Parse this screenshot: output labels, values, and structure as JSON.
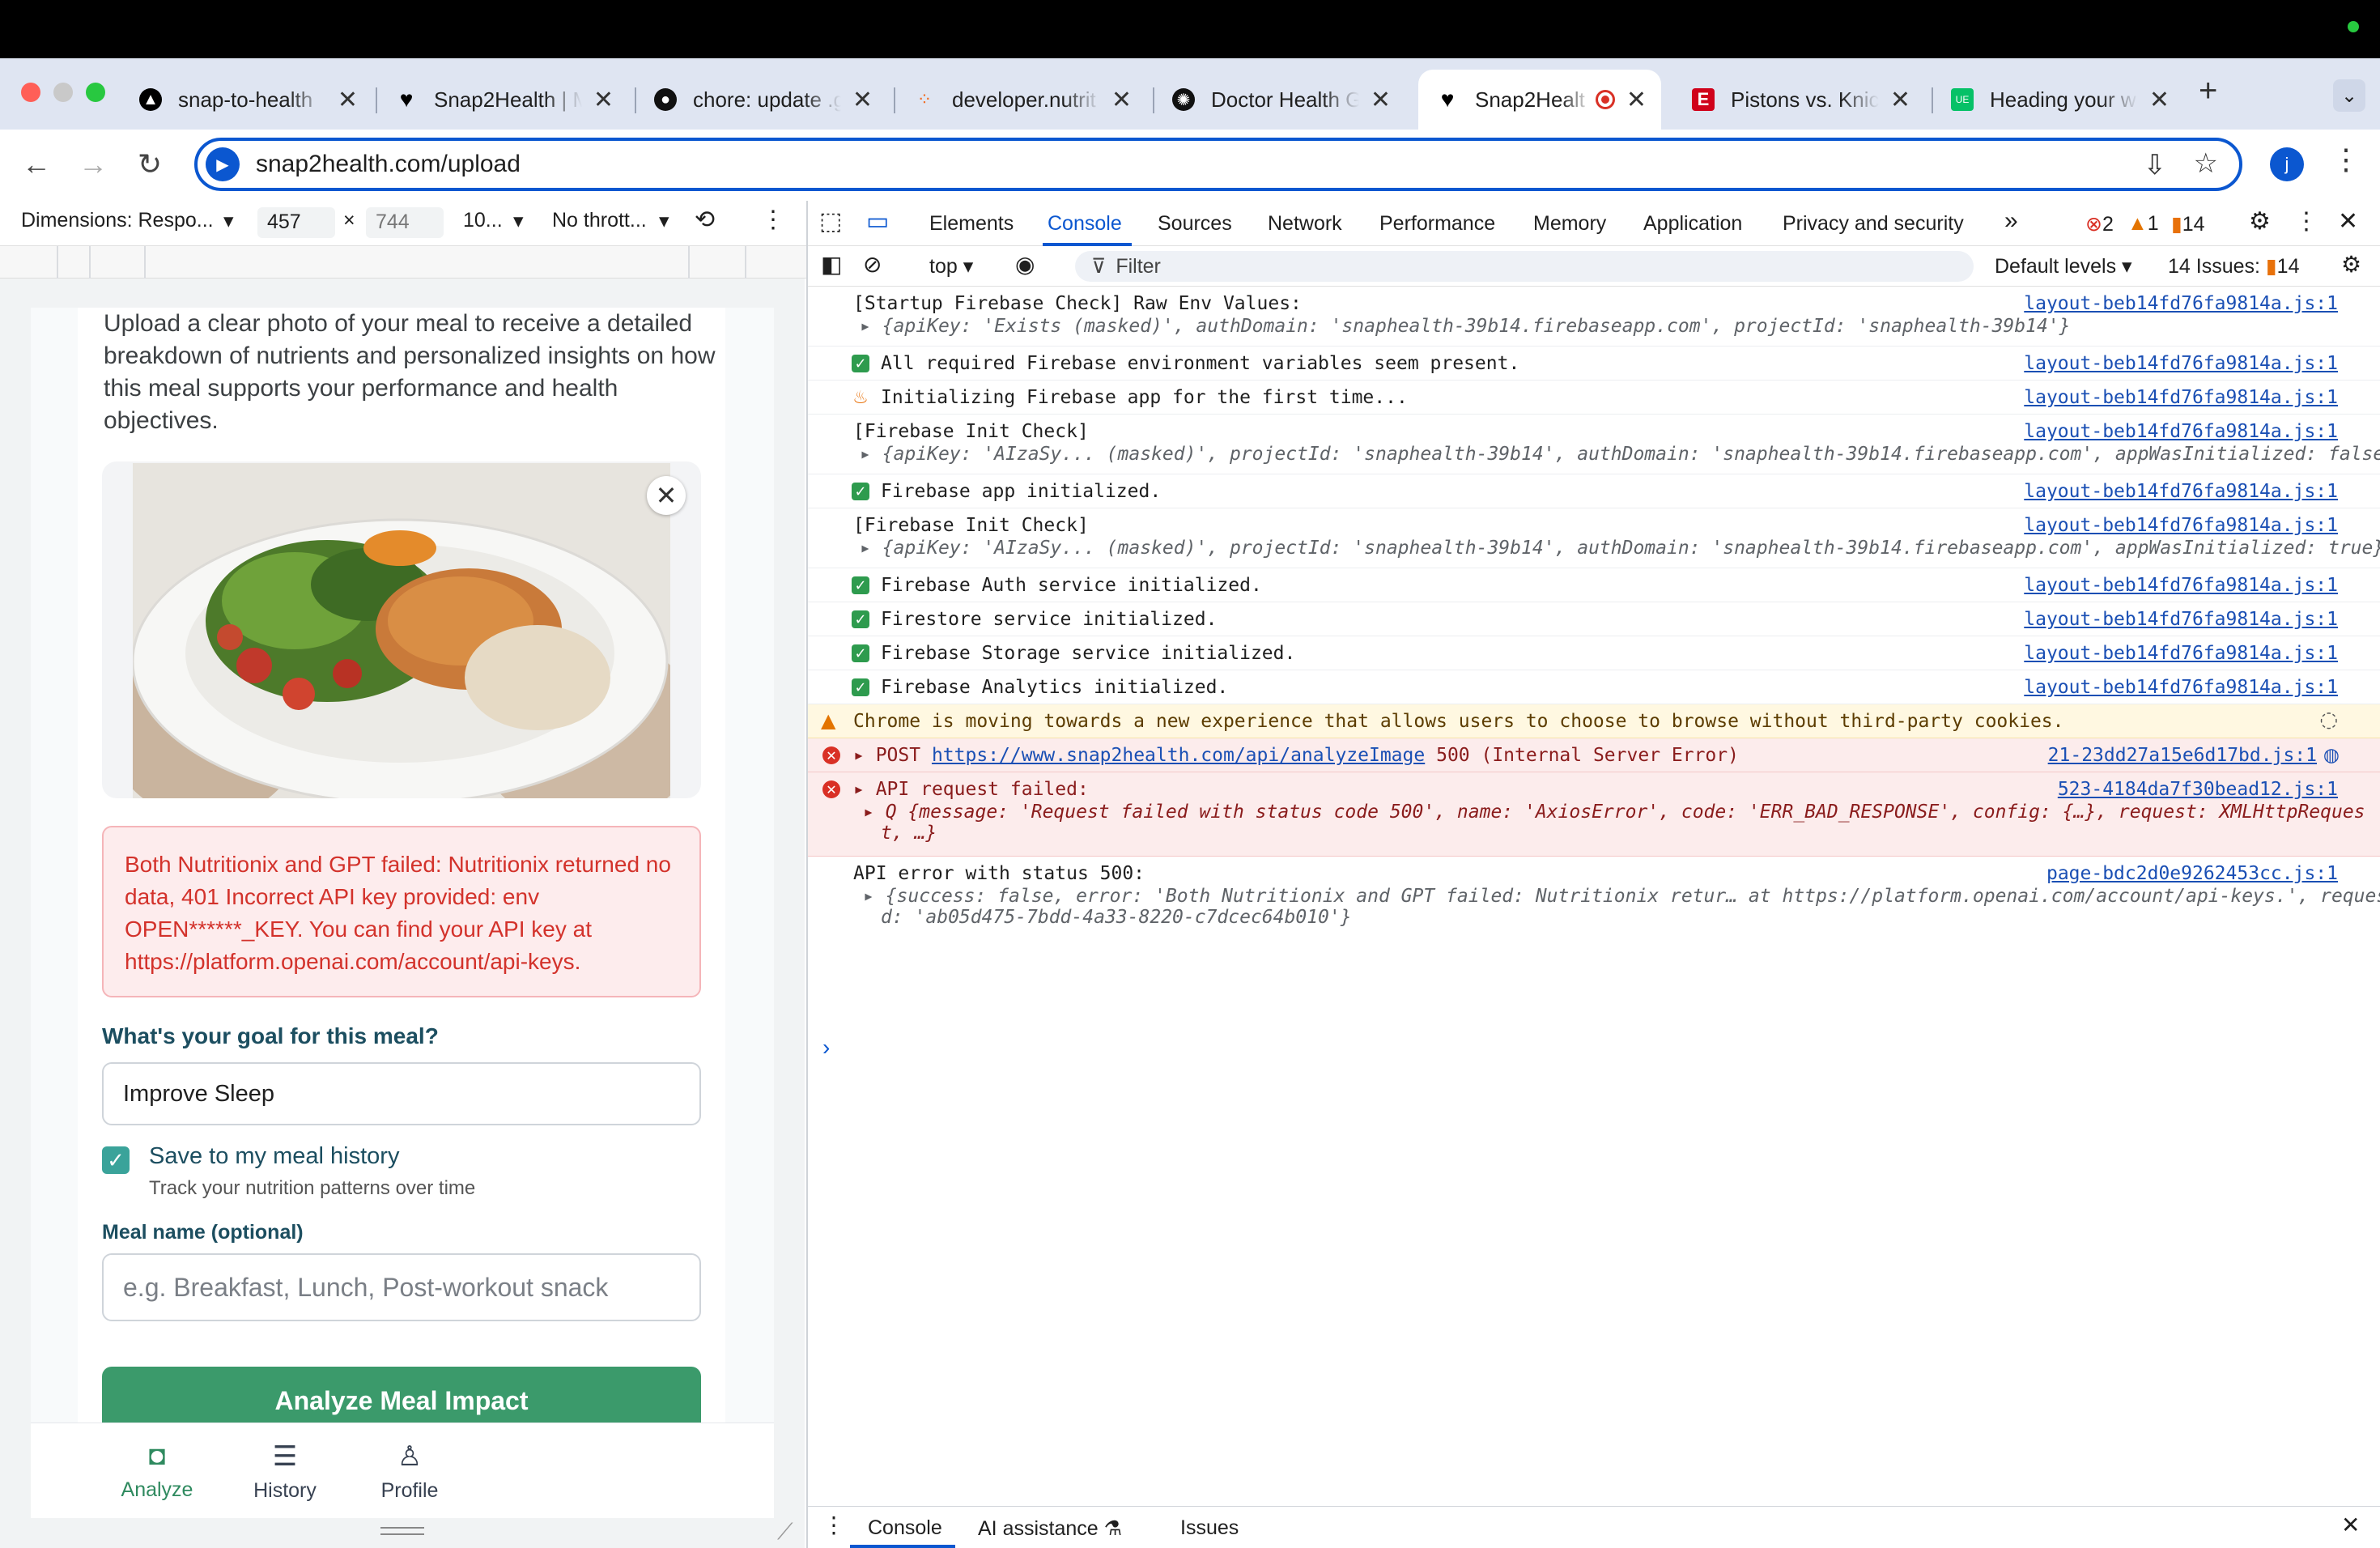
{
  "browser": {
    "tabs": [
      {
        "title": "snap-to-health",
        "favicon": "triangle-icon",
        "active": false
      },
      {
        "title": "Snap2Health | M",
        "favicon": "heart-icon",
        "active": false
      },
      {
        "title": "chore: update .g",
        "favicon": "github-icon",
        "active": false
      },
      {
        "title": "developer.nutrit",
        "favicon": "dots-icon",
        "active": false
      },
      {
        "title": "Doctor Health G",
        "favicon": "openai-icon",
        "active": false
      },
      {
        "title": "Snap2Healt",
        "favicon": "heart-icon",
        "active": true
      },
      {
        "title": "Pistons vs. Knic",
        "favicon": "espn-icon",
        "active": false
      },
      {
        "title": "Heading your w",
        "favicon": "ubereats-icon",
        "active": false
      }
    ],
    "url": "snap2health.com/upload",
    "avatar_letter": "j",
    "new_tab": "+"
  },
  "device_toolbar": {
    "dimensions_label": "Dimensions: Respo...",
    "width": "457",
    "height": "744",
    "zoom": "10...",
    "throttle": "No thrott..."
  },
  "app": {
    "intro": "Upload a clear photo of your meal to receive a detailed breakdown of nutrients and personalized insights on how this meal supports your performance and health objectives.",
    "error": "Both Nutritionix and GPT failed: Nutritionix returned no data, 401 Incorrect API key provided: env OPEN******_KEY. You can find your API key at https://platform.openai.com/account/api-keys.",
    "goal_label": "What's your goal for this meal?",
    "goal_value": "Improve Sleep",
    "save_label": "Save to my meal history",
    "save_sub": "Track your nutrition patterns over time",
    "meal_name_label": "Meal name (optional)",
    "meal_name_placeholder": "e.g. Breakfast, Lunch, Post-workout snack",
    "analyze_button": "Analyze Meal Impact",
    "nav": {
      "analyze": "Analyze",
      "history": "History",
      "profile": "Profile"
    }
  },
  "devtools": {
    "tabs": [
      "Elements",
      "Console",
      "Sources",
      "Network",
      "Performance",
      "Memory",
      "Application",
      "Privacy and security"
    ],
    "active_tab": "Console",
    "badges": {
      "errors": "2",
      "warnings": "1",
      "info": "14"
    },
    "context": "top",
    "filter_placeholder": "Filter",
    "levels": "Default levels",
    "issues": "14 Issues:",
    "issues_count": "14",
    "drawer_tabs": [
      "Console",
      "AI assistance",
      "Issues"
    ],
    "logs": [
      {
        "text": "[Startup Firebase Check] Raw Env Values:",
        "src": "layout-beb14fd76fa9814a.js:1",
        "sub": "{apiKey: 'Exists (masked)', authDomain: 'snaphealth-39b14.firebaseapp.com', projectId: 'snaphealth-39b14'}"
      },
      {
        "text": "All required Firebase environment variables seem present.",
        "src": "layout-beb14fd76fa9814a.js:1"
      },
      {
        "text": "Initializing Firebase app for the first time...",
        "src": "layout-beb14fd76fa9814a.js:1"
      },
      {
        "text": "[Firebase Init Check]",
        "src": "layout-beb14fd76fa9814a.js:1",
        "sub": "{apiKey: 'AIzaSy... (masked)', projectId: 'snaphealth-39b14', authDomain: 'snaphealth-39b14.firebaseapp.com', appWasInitialized: false}"
      },
      {
        "text": "Firebase app initialized.",
        "src": "layout-beb14fd76fa9814a.js:1"
      },
      {
        "text": "[Firebase Init Check]",
        "src": "layout-beb14fd76fa9814a.js:1",
        "sub": "{apiKey: 'AIzaSy... (masked)', projectId: 'snaphealth-39b14', authDomain: 'snaphealth-39b14.firebaseapp.com', appWasInitialized: true}"
      },
      {
        "text": "Firebase Auth service initialized.",
        "src": "layout-beb14fd76fa9814a.js:1"
      },
      {
        "text": "Firestore service initialized.",
        "src": "layout-beb14fd76fa9814a.js:1"
      },
      {
        "text": "Firebase Storage service initialized.",
        "src": "layout-beb14fd76fa9814a.js:1"
      },
      {
        "text": "Firebase Analytics initialized.",
        "src": "layout-beb14fd76fa9814a.js:1"
      },
      {
        "text": "Chrome is moving towards a new experience that allows users to choose to browse without third-party cookies."
      },
      {
        "text": "POST",
        "url": "https://www.snap2health.com/api/analyzeImage",
        "status": "500 (Internal Server Error)",
        "src": "21-23dd27a15e6d17bd.js:1"
      },
      {
        "text": "API request failed:",
        "src": "523-4184da7f30bead12.js:1",
        "sub": "Q {message: 'Request failed with status code 500', name: 'AxiosError', code: 'ERR_BAD_RESPONSE', config: {…}, request: XMLHttpReques",
        "sub2": "t, …}"
      },
      {
        "text": "API error with status 500:",
        "src": "page-bdc2d0e9262453cc.js:1",
        "sub": "{success: false, error: 'Both Nutritionix and GPT failed: Nutritionix retur… at https://platform.openai.com/account/api-keys.', requestI",
        "sub2": "d: 'ab05d475-7bdd-4a33-8220-c7dcec64b010'}"
      }
    ],
    "prompt": "›"
  }
}
